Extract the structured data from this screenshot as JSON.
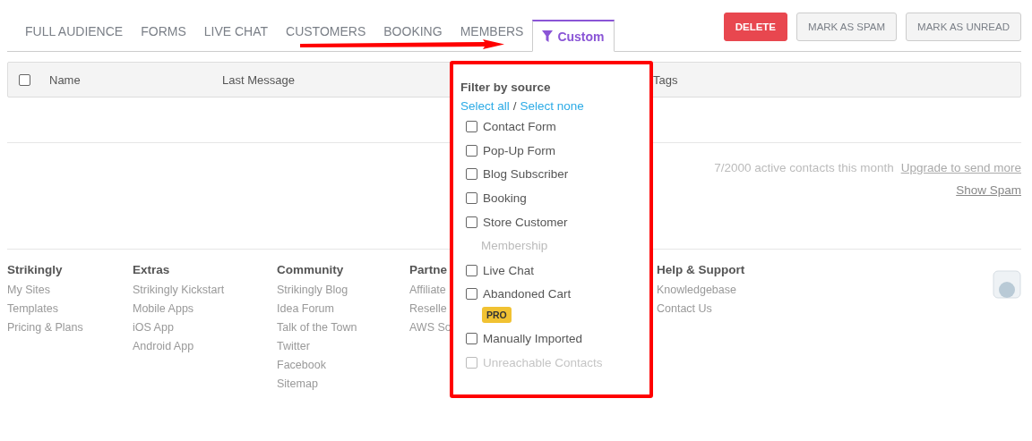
{
  "tabs": [
    {
      "label": "FULL AUDIENCE",
      "selected": false,
      "kind": "text"
    },
    {
      "label": "FORMS",
      "selected": false,
      "kind": "text"
    },
    {
      "label": "LIVE CHAT",
      "selected": false,
      "kind": "text"
    },
    {
      "label": "CUSTOMERS",
      "selected": false,
      "kind": "text"
    },
    {
      "label": "BOOKING",
      "selected": false,
      "kind": "text"
    },
    {
      "label": "MEMBERS",
      "selected": false,
      "kind": "text"
    },
    {
      "label": "Custom",
      "selected": true,
      "kind": "filter"
    }
  ],
  "actions": [
    {
      "label": "DELETE",
      "kind": "danger"
    },
    {
      "label": "MARK AS SPAM",
      "kind": "plain"
    },
    {
      "label": "MARK AS UNREAD",
      "kind": "plain"
    }
  ],
  "table": {
    "select_all_checked": false,
    "columns": [
      "Name",
      "Last Message",
      "Tags"
    ]
  },
  "usage": {
    "text": "7/2000 active contacts this month",
    "link": "Upgrade to send more"
  },
  "show_spam": "Show Spam",
  "filter": {
    "title": "Filter by source",
    "select_all": "Select all",
    "separator": "/",
    "select_none": "Select none",
    "options": [
      {
        "label": "Contact Form",
        "kind": "checkbox",
        "checked": false,
        "disabled": false
      },
      {
        "label": "Pop-Up Form",
        "kind": "checkbox",
        "checked": false,
        "disabled": false
      },
      {
        "label": "Blog Subscriber",
        "kind": "checkbox",
        "checked": false,
        "disabled": false
      },
      {
        "label": "Booking",
        "kind": "checkbox",
        "checked": false,
        "disabled": false
      },
      {
        "label": "Store Customer",
        "kind": "checkbox",
        "checked": false,
        "disabled": false
      },
      {
        "label": "Membership",
        "kind": "text",
        "disabled": true
      },
      {
        "label": "Live Chat",
        "kind": "checkbox",
        "checked": false,
        "disabled": false
      },
      {
        "label": "Abandoned Cart",
        "kind": "checkbox",
        "checked": false,
        "disabled": false,
        "badge": "PRO"
      },
      {
        "label": "Manually Imported",
        "kind": "checkbox",
        "checked": false,
        "disabled": false
      },
      {
        "label": "Unreachable Contacts",
        "kind": "checkbox",
        "checked": false,
        "disabled": true
      }
    ]
  },
  "footer": [
    {
      "title": "Strikingly",
      "links": [
        "My Sites",
        "Templates",
        "Pricing & Plans"
      ]
    },
    {
      "title": "Extras",
      "links": [
        "Strikingly Kickstart",
        "Mobile Apps",
        "iOS App",
        "Android App"
      ]
    },
    {
      "title": "Community",
      "links": [
        "Strikingly Blog",
        "Idea Forum",
        "Talk of the Town",
        "Twitter",
        "Facebook",
        "Sitemap"
      ]
    },
    {
      "title": "Partne",
      "links": [
        "Affiliate",
        "Reselle",
        "AWS So"
      ]
    },
    {
      "title": "Help & Support",
      "links": [
        "Knowledgebase",
        "Contact Us"
      ]
    }
  ]
}
